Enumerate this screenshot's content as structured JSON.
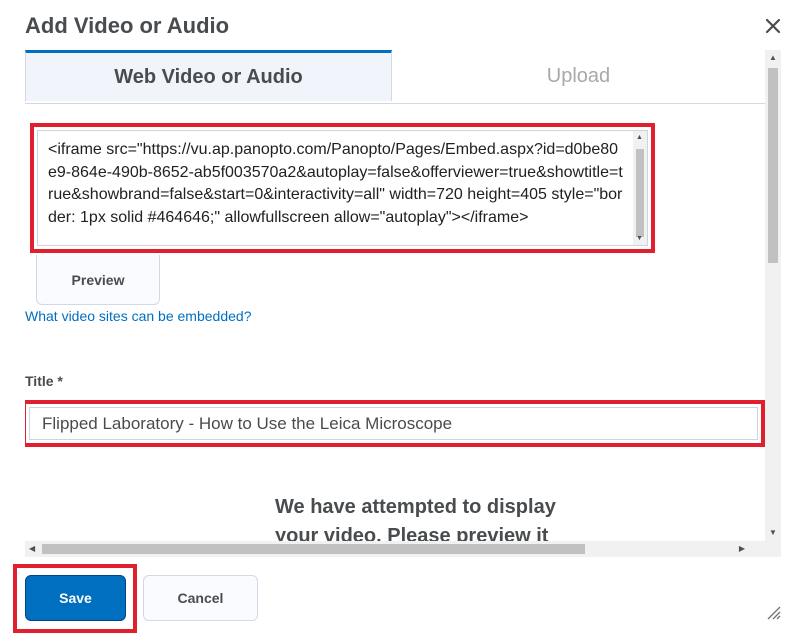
{
  "dialog": {
    "title": "Add Video or Audio",
    "close_icon": "close-icon"
  },
  "tabs": [
    {
      "label": "Web Video or Audio",
      "active": true
    },
    {
      "label": "Upload",
      "active": false
    }
  ],
  "embed": {
    "value": "<iframe src=\"https://vu.ap.panopto.com/Panopto/Pages/Embed.aspx?id=d0be80e9-864e-490b-8652-ab5f003570a2&autoplay=false&offerviewer=true&showtitle=true&showbrand=false&start=0&interactivity=all\" width=720 height=405 style=\"border: 1px solid #464646;\" allowfullscreen allow=\"autoplay\"></iframe>"
  },
  "preview_button": "Preview",
  "embed_sites_link": "What video sites can be embedded?",
  "title_field": {
    "label": "Title *",
    "value": "Flipped Laboratory - How to Use the Leica Microscope"
  },
  "message": "We have attempted to display your video. Please preview it",
  "footer": {
    "save": "Save",
    "cancel": "Cancel"
  },
  "colors": {
    "primary": "#006fbf",
    "highlight": "#e0202e"
  }
}
